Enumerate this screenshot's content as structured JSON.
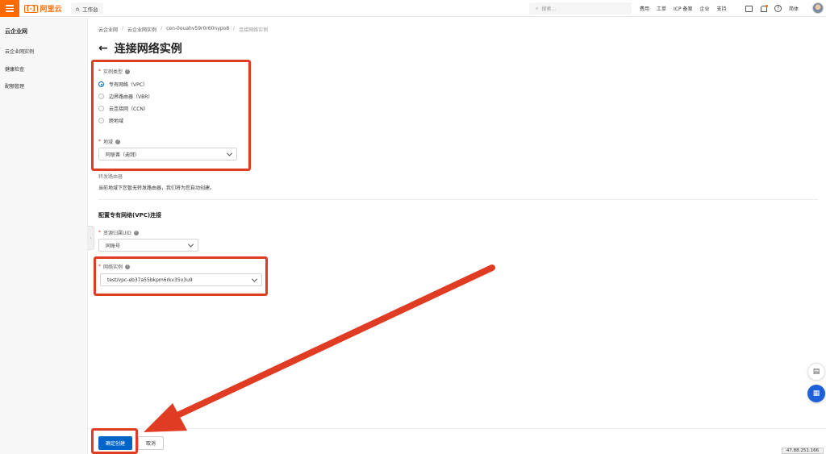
{
  "header": {
    "brand": "阿里云",
    "brand_mark": "[-]",
    "workbench_label": "工作台",
    "search_placeholder": "搜索...",
    "links": [
      "费用",
      "工单",
      "ICP 备案",
      "企业",
      "支持"
    ],
    "lang_label": "简体"
  },
  "sidebar": {
    "title": "云企业网",
    "items": [
      {
        "label": "云企业网实例"
      },
      {
        "label": "健康检查"
      },
      {
        "label": "配额管理"
      }
    ]
  },
  "breadcrumb": {
    "items": [
      "云企业网",
      "云企业网实例",
      "cen-0ouahv59r0r60nypo8",
      "连接网络实例"
    ],
    "separator": "/"
  },
  "page": {
    "title": "连接网络实例",
    "back_arrow": "←"
  },
  "form": {
    "required_mark": "*",
    "help_glyph": "?",
    "instance_type": {
      "label": "实例类型",
      "options": [
        {
          "label": "专有网络（VPC）",
          "checked": true
        },
        {
          "label": "边界路由器（VBR）",
          "checked": false
        },
        {
          "label": "云连接网（CCN）",
          "checked": false
        },
        {
          "label": "跨地域",
          "checked": false
        }
      ]
    },
    "region": {
      "label": "地域",
      "value": "阿联酋（迪拜）"
    },
    "transit_router": {
      "label": "转发路由器",
      "note": "当前地域下您暂无转发路由器，我们将为您自动创建。"
    },
    "vpc_section_title": "配置专有网络(VPC)连接",
    "resource_uid": {
      "label": "资源归属UID",
      "value": "同账号"
    },
    "network_instance": {
      "label": "网络实例",
      "value": "test/vpc-eb37a55bkpm6rkv35v3u9"
    }
  },
  "footer": {
    "confirm_label": "确定创建",
    "cancel_label": "取消"
  },
  "floating": {
    "chat_icon": "chat-icon",
    "apps_icon": "apps-icon"
  },
  "ip_badge": "47.88.251.166",
  "colors": {
    "brand_orange": "#ff6a00",
    "primary_blue": "#0064c8",
    "annotation_red": "#e03c24"
  }
}
